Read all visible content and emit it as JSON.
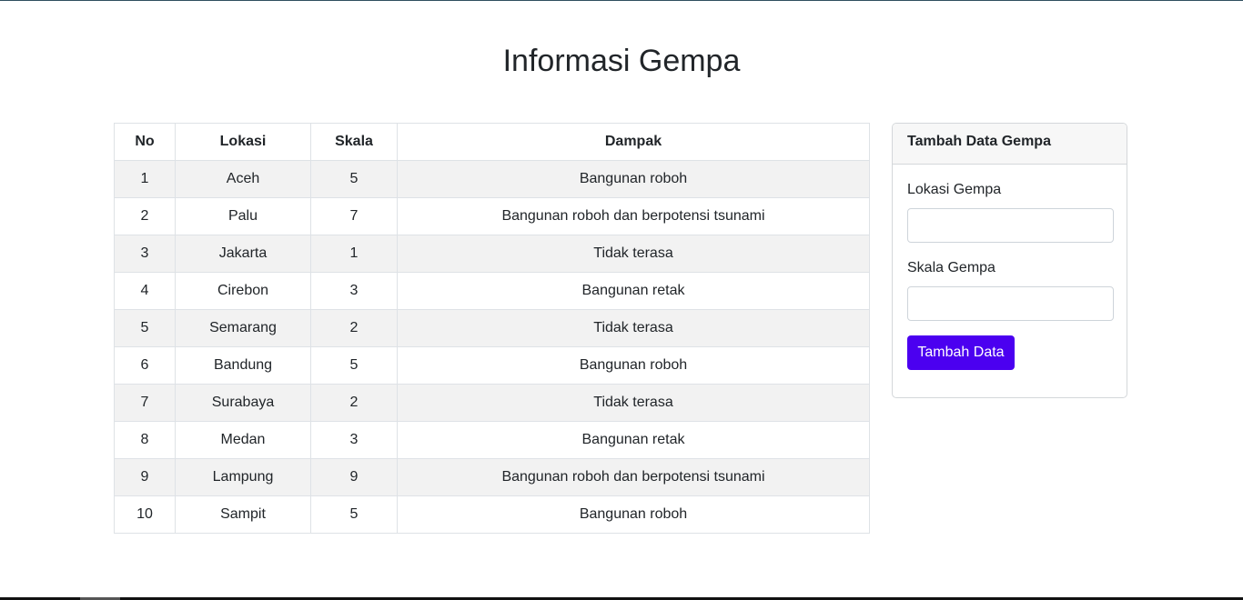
{
  "page": {
    "title": "Informasi Gempa"
  },
  "table": {
    "headers": [
      "No",
      "Lokasi",
      "Skala",
      "Dampak"
    ],
    "rows": [
      {
        "no": "1",
        "lokasi": "Aceh",
        "skala": "5",
        "dampak": "Bangunan roboh"
      },
      {
        "no": "2",
        "lokasi": "Palu",
        "skala": "7",
        "dampak": "Bangunan roboh dan berpotensi tsunami"
      },
      {
        "no": "3",
        "lokasi": "Jakarta",
        "skala": "1",
        "dampak": "Tidak terasa"
      },
      {
        "no": "4",
        "lokasi": "Cirebon",
        "skala": "3",
        "dampak": "Bangunan retak"
      },
      {
        "no": "5",
        "lokasi": "Semarang",
        "skala": "2",
        "dampak": "Tidak terasa"
      },
      {
        "no": "6",
        "lokasi": "Bandung",
        "skala": "5",
        "dampak": "Bangunan roboh"
      },
      {
        "no": "7",
        "lokasi": "Surabaya",
        "skala": "2",
        "dampak": "Tidak terasa"
      },
      {
        "no": "8",
        "lokasi": "Medan",
        "skala": "3",
        "dampak": "Bangunan retak"
      },
      {
        "no": "9",
        "lokasi": "Lampung",
        "skala": "9",
        "dampak": "Bangunan roboh dan berpotensi tsunami"
      },
      {
        "no": "10",
        "lokasi": "Sampit",
        "skala": "5",
        "dampak": "Bangunan roboh"
      }
    ]
  },
  "form": {
    "header": "Tambah Data Gempa",
    "lokasi_label": "Lokasi Gempa",
    "lokasi_value": "",
    "skala_label": "Skala Gempa",
    "skala_value": "",
    "submit_label": "Tambah Data"
  },
  "colors": {
    "accent": "#4b00f0",
    "stripe": "#f2f2f2",
    "border": "#dee2e6"
  }
}
